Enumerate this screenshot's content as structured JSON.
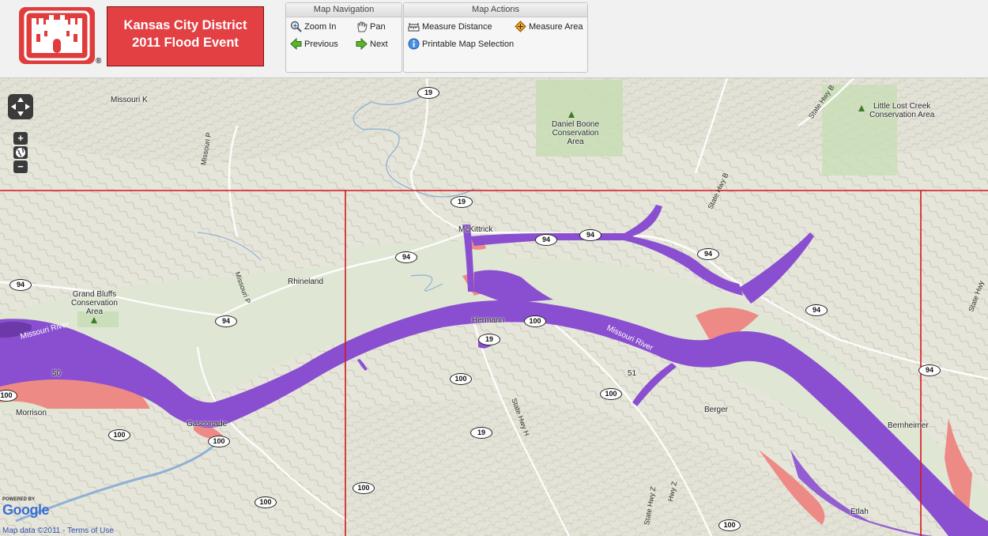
{
  "header": {
    "logo_reg": "®",
    "title_line1": "Kansas City District",
    "title_line2": "2011 Flood Event"
  },
  "navigation_panel": {
    "title": "Map Navigation",
    "zoom_in": "Zoom In",
    "pan": "Pan",
    "previous": "Previous",
    "next": "Next"
  },
  "actions_panel": {
    "title": "Map Actions",
    "measure_distance": "Measure Distance",
    "measure_area": "Measure Area",
    "printable_map": "Printable Map Selection"
  },
  "map": {
    "zoom_in_symbol": "+",
    "zoom_out_symbol": "−",
    "labels": {
      "missouri_k": "Missouri K",
      "missouri_p_north": "Missouri P",
      "missouri_p_mid": "Missouri P",
      "daniel_boone": "Daniel Boone\nConservation\nArea",
      "little_lost": "Little Lost Creek\nConservation Area",
      "state_hwy_b_top": "State Hwy B",
      "state_hwy_b_mid": "State Hwy B",
      "mckittrick": "McKittrick",
      "rhineland": "Rhineland",
      "grand_bluffs": "Grand Bluffs\nConservation\nArea",
      "missouri_river_west": "Missouri River",
      "missouri_river_east": "Missouri River",
      "hermann": "Hermann",
      "morrison": "Morrison",
      "gasconade": "Gasconade",
      "berger": "Berger",
      "bernheimer": "Bernheimer",
      "etlah": "Etlah",
      "state_hwy_h": "State Hwy H",
      "state_hwy_z": "State Hwy Z",
      "hwy_z": "Hwy Z",
      "state_hwy_east": "State Hwy",
      "num_50": "50",
      "num_51": "51"
    },
    "shields": {
      "s19_top": "19",
      "s19_mid": "19",
      "s19_hermann": "19",
      "s19_south": "19",
      "s94_mck1": "94",
      "s94_mck2": "94",
      "s94_west": "94",
      "s94_rhine": "94",
      "s94_mid": "94",
      "s94_east": "94",
      "s94_far": "94",
      "s94_edge": "94",
      "s100_herm": "100",
      "s100_a": "100",
      "s100_b": "100",
      "s100_c": "100",
      "s100_gas": "100",
      "s100_morr": "100",
      "s100_sw": "100",
      "s100_bot": "100",
      "s100_bot2": "100",
      "s100_edge": "100"
    },
    "powered_by": "POWERED BY",
    "google": "Google",
    "attribution": "Map data ©2011 - Terms of Use",
    "colors": {
      "flood_purple": "#8a4fd0",
      "flood_pink": "#ee8a86",
      "grid_red": "#d4161c",
      "land": "#e8e7dc",
      "floodplain": "#dfe6d3",
      "park": "#c7ddb4"
    }
  }
}
